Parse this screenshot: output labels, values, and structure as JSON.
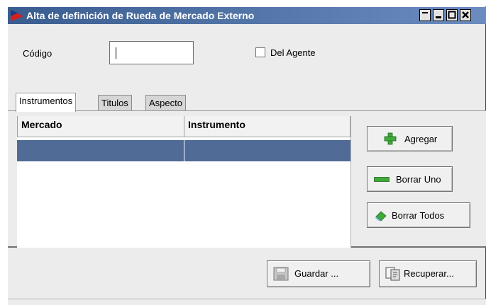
{
  "window": {
    "title": "Alta de definición de Rueda de Mercado Externo",
    "titlebar_color": "#3a5d8f",
    "controls": [
      "restore-icon",
      "minimize-icon",
      "maximize-icon",
      "close-icon"
    ]
  },
  "form": {
    "codigo_label": "Código",
    "codigo_value": "",
    "del_agente_label": "Del Agente",
    "del_agente_checked": false
  },
  "tabs": [
    {
      "label": "Instrumentos",
      "active": true
    },
    {
      "label": "Titulos",
      "active": false
    },
    {
      "label": "Aspecto",
      "active": false
    }
  ],
  "table": {
    "columns": [
      "Mercado",
      "Instrumento"
    ],
    "rows": [
      [
        "",
        ""
      ]
    ],
    "selected_row_color": "#4f6b96"
  },
  "side_buttons": {
    "agregar": "Agregar",
    "borrar_uno": "Borrar Uno",
    "borrar_todos": "Borrar Todos"
  },
  "footer_buttons": {
    "guardar": "Guardar ...",
    "recuperar": "Recuperar..."
  }
}
